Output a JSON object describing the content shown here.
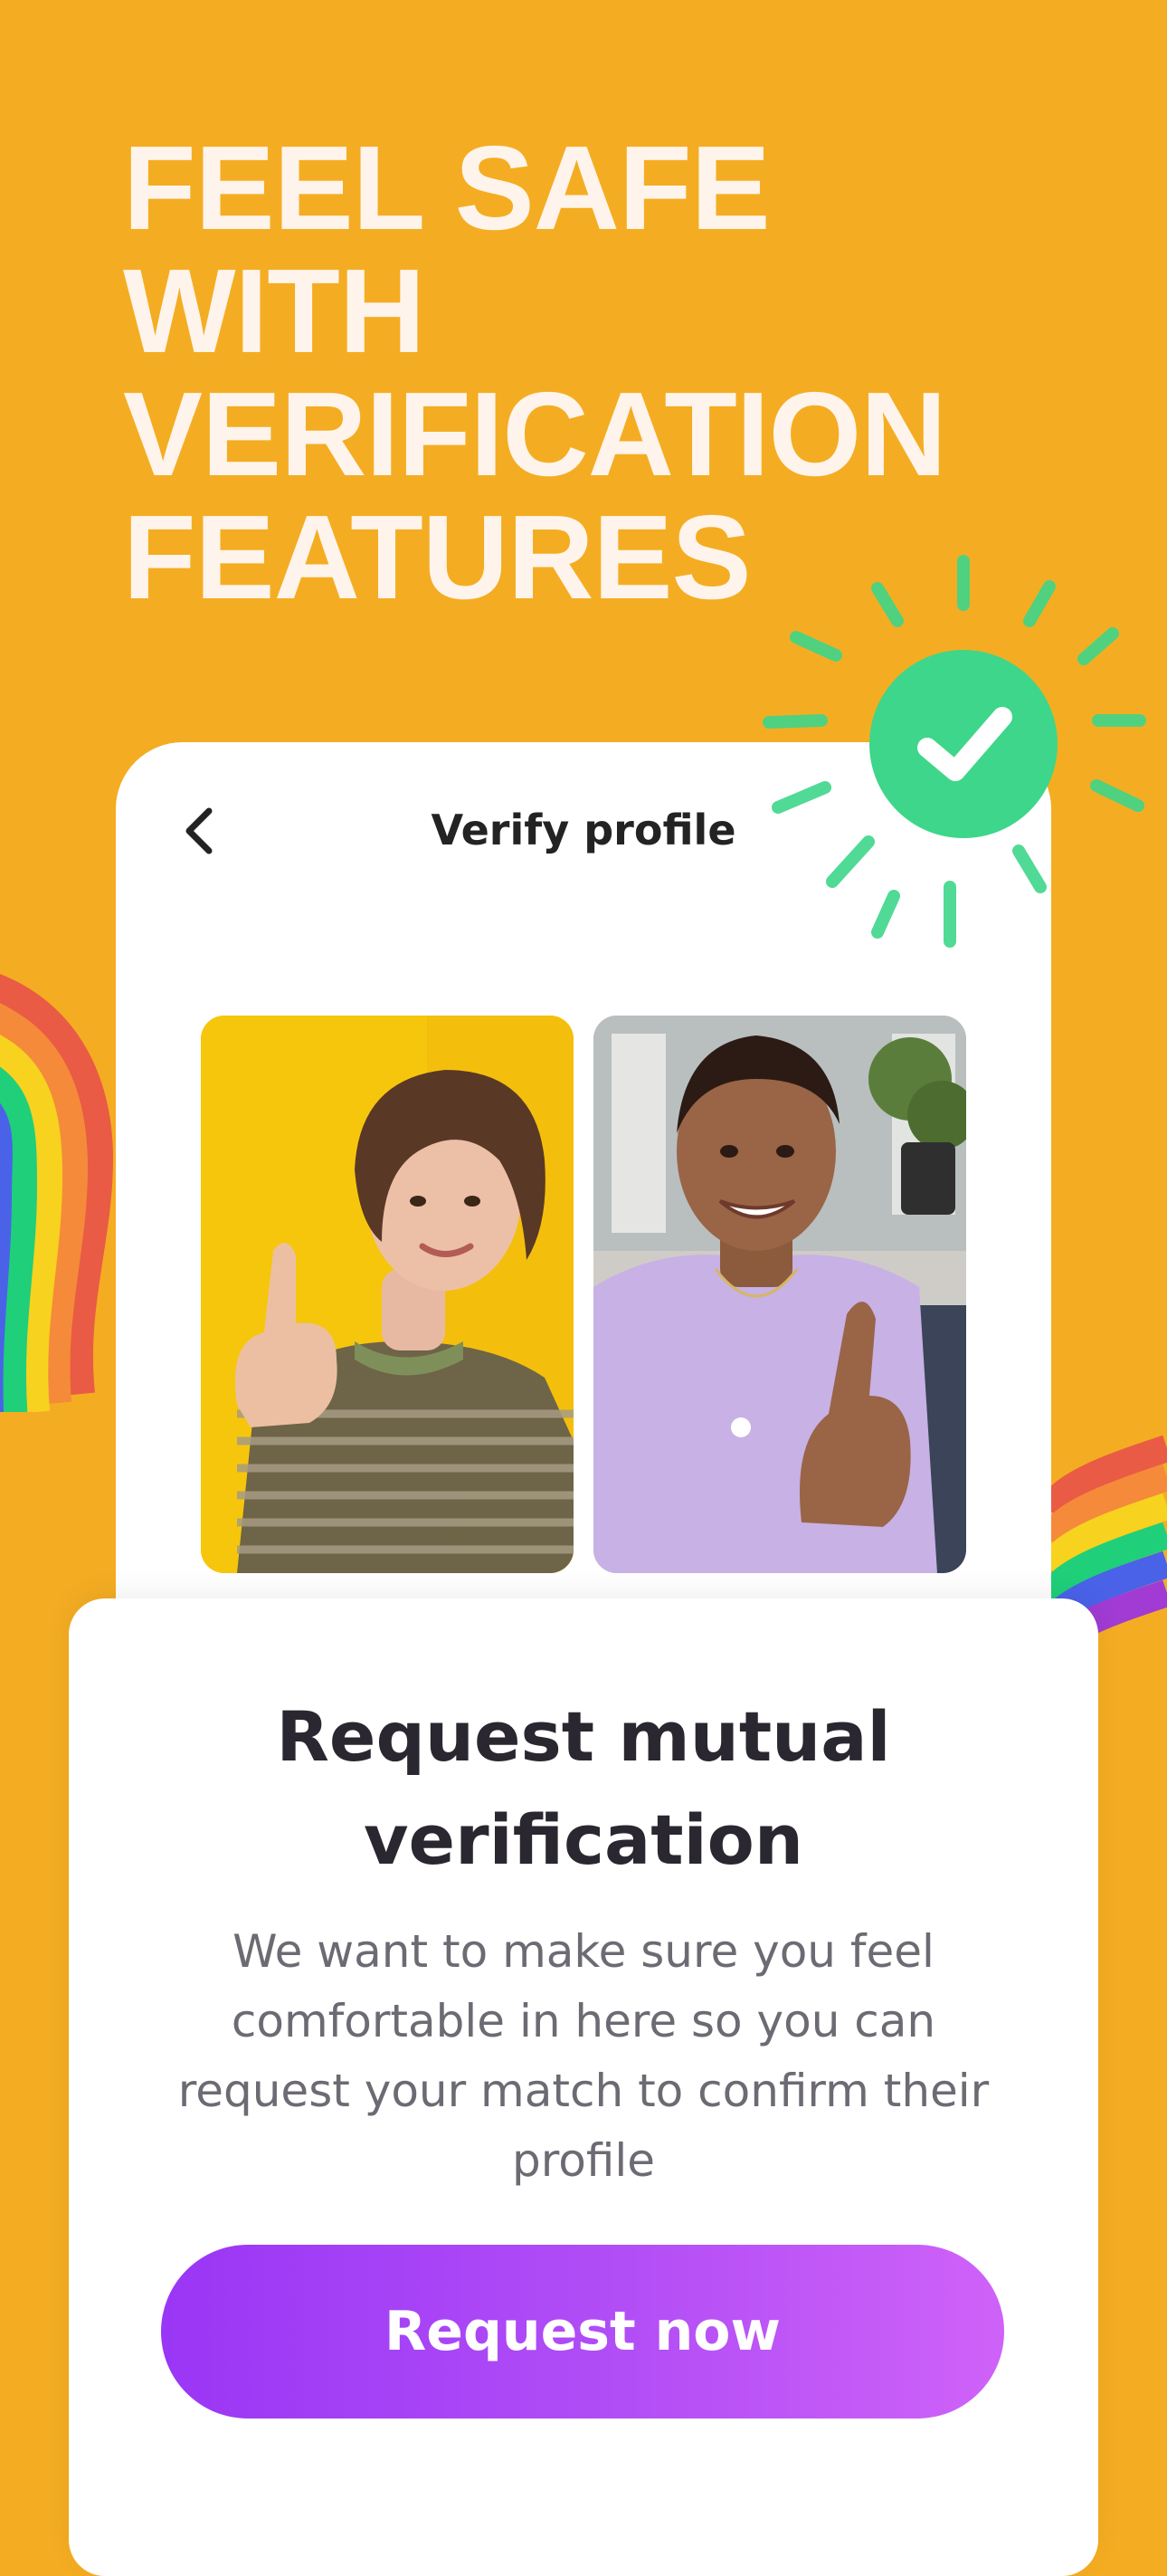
{
  "headline": "FEEL SAFE\nWITH\nVERIFICATION\nFEATURES",
  "screen": {
    "title": "Verify profile",
    "back_icon": "chevron-left-icon",
    "badge_icon": "checkmark-icon"
  },
  "sheet": {
    "title": "Request mutual verification",
    "body": "We want to make sure you feel comfortable in here so you can request your match to confirm their profile",
    "cta_label": "Request now"
  },
  "colors": {
    "background": "#f4ad22",
    "badge": "#3ed68a",
    "cta_start": "#9a36f5",
    "cta_end": "#cf62f8"
  }
}
